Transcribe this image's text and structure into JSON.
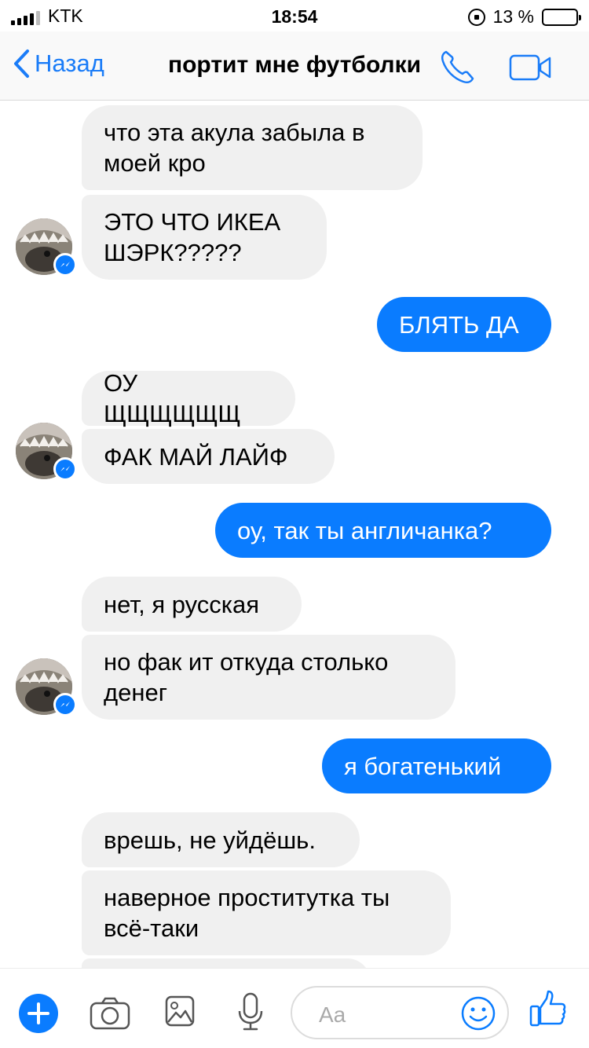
{
  "status_bar": {
    "carrier": "KTK",
    "time": "18:54",
    "battery_percent": "13 %",
    "battery_level": 0.13
  },
  "nav": {
    "back_label": "Назад",
    "title": "портит мне футболки"
  },
  "messages": [
    {
      "side": "in",
      "text": "что эта акула забыла в моей кро"
    },
    {
      "side": "in",
      "text": "ЭТО ЧТО ИКЕА ШЭРК?????"
    },
    {
      "side": "out",
      "text": "БЛЯТЬ ДА"
    },
    {
      "side": "in",
      "text": "ОУ ЩЩЩЩЩЩ"
    },
    {
      "side": "in",
      "text": "ФАК МАЙ ЛАЙФ"
    },
    {
      "side": "out",
      "text": "оу, так ты англичанка?"
    },
    {
      "side": "in",
      "text": "нет, я русская"
    },
    {
      "side": "in",
      "text": "но фак ит откуда столько денег"
    },
    {
      "side": "out",
      "text": "я богатенький"
    },
    {
      "side": "in",
      "text": "врешь, не уйдёшь."
    },
    {
      "side": "in",
      "text": "наверное проститутка ты всё-таки"
    }
  ],
  "composer": {
    "placeholder": "Aa"
  },
  "colors": {
    "accent": "#0a7cff",
    "incoming_bubble": "#f0f0f0",
    "battery": "#f5c518"
  },
  "icons": [
    "plus-icon",
    "camera-icon",
    "image-icon",
    "microphone-icon",
    "emoji-icon",
    "thumbs-up-icon",
    "phone-icon",
    "video-icon",
    "chevron-left-icon"
  ]
}
